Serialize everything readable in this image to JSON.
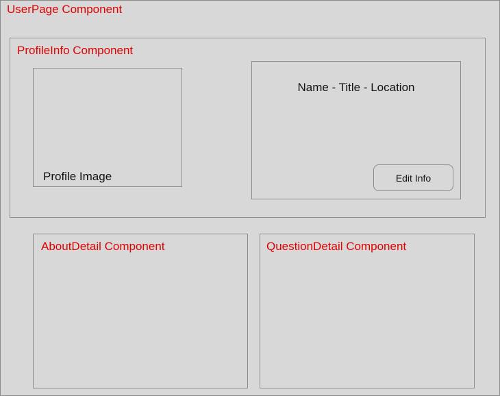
{
  "userpage": {
    "title": "UserPage Component"
  },
  "profileinfo": {
    "title": "ProfileInfo Component",
    "profile_image_label": "Profile Image",
    "info_text": "Name - Title - Location",
    "edit_button_label": "Edit Info"
  },
  "aboutdetail": {
    "title": "AboutDetail Component"
  },
  "questiondetail": {
    "title": "QuestionDetail Component"
  },
  "colors": {
    "component_label": "#e00000",
    "background": "#d8d8d8",
    "border": "#8c8c8c"
  }
}
